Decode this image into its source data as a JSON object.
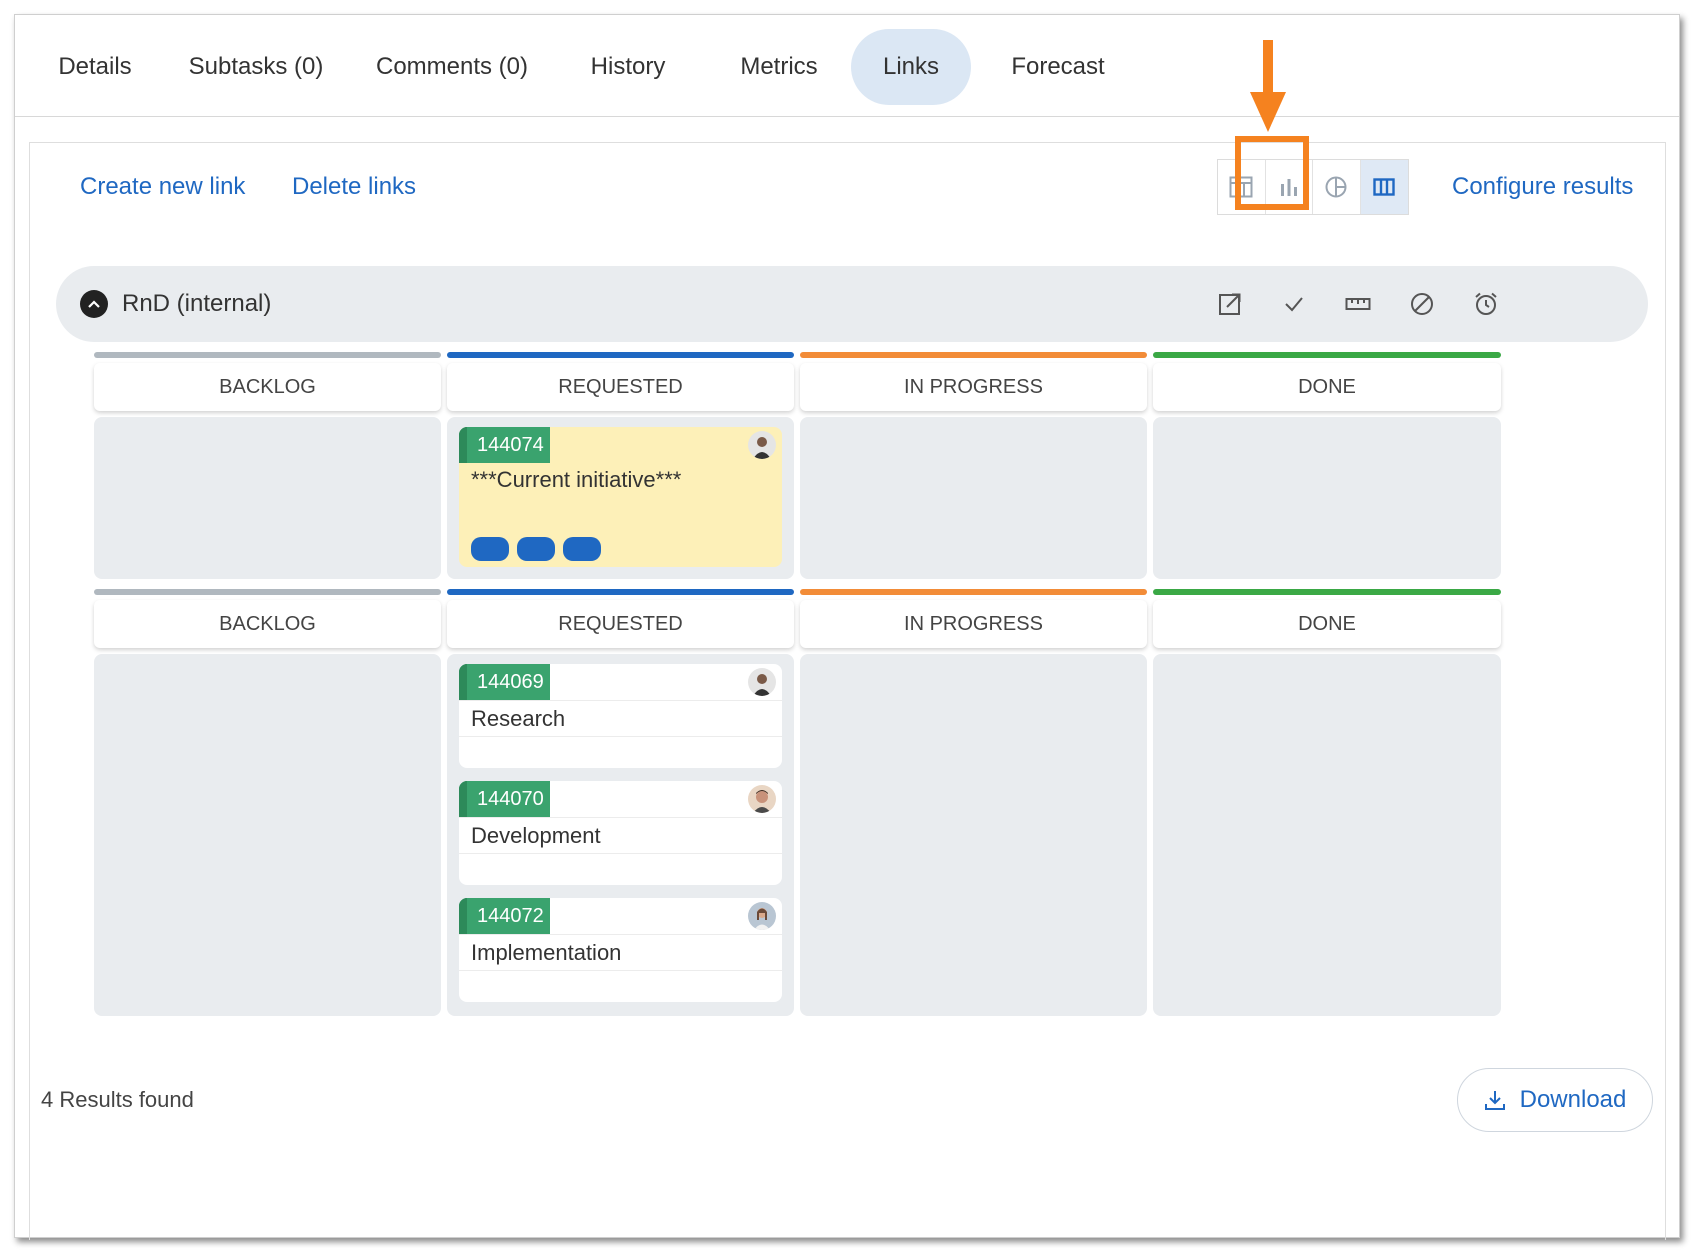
{
  "tabs": [
    {
      "label": "Details"
    },
    {
      "label": "Subtasks (0)"
    },
    {
      "label": "Comments (0)"
    },
    {
      "label": "History"
    },
    {
      "label": "Metrics"
    },
    {
      "label": "Links",
      "active": true
    },
    {
      "label": "Forecast"
    }
  ],
  "toolbar": {
    "create_link": "Create new link",
    "delete_links": "Delete links",
    "configure_results": "Configure results",
    "views": [
      "table-view-icon",
      "bar-chart-view-icon",
      "pie-chart-view-icon",
      "board-view-icon"
    ],
    "active_view": "board-view-icon"
  },
  "group": {
    "title": "RnD (internal)",
    "icons": [
      "open-external-icon",
      "check-icon",
      "ruler-icon",
      "cancel-icon",
      "alarm-clock-icon"
    ]
  },
  "columns": [
    {
      "label": "BACKLOG",
      "color": "#b0b8bf"
    },
    {
      "label": "REQUESTED",
      "color": "#1f68c2"
    },
    {
      "label": "IN PROGRESS",
      "color": "#f28c38"
    },
    {
      "label": "DONE",
      "color": "#3aa845"
    }
  ],
  "lanes": [
    {
      "cards": [
        {
          "id": "144074",
          "title": "***Current initiative***",
          "style": "yellow",
          "tags": 3
        }
      ]
    },
    {
      "cards": [
        {
          "id": "144069",
          "title": "Research"
        },
        {
          "id": "144070",
          "title": "Development"
        },
        {
          "id": "144072",
          "title": "Implementation"
        }
      ]
    }
  ],
  "footer": {
    "results": "4 Results found",
    "download": "Download"
  },
  "colors": {
    "accent": "#1f68c2",
    "highlight": "#f5821f",
    "card_id": "#3aa36e"
  }
}
